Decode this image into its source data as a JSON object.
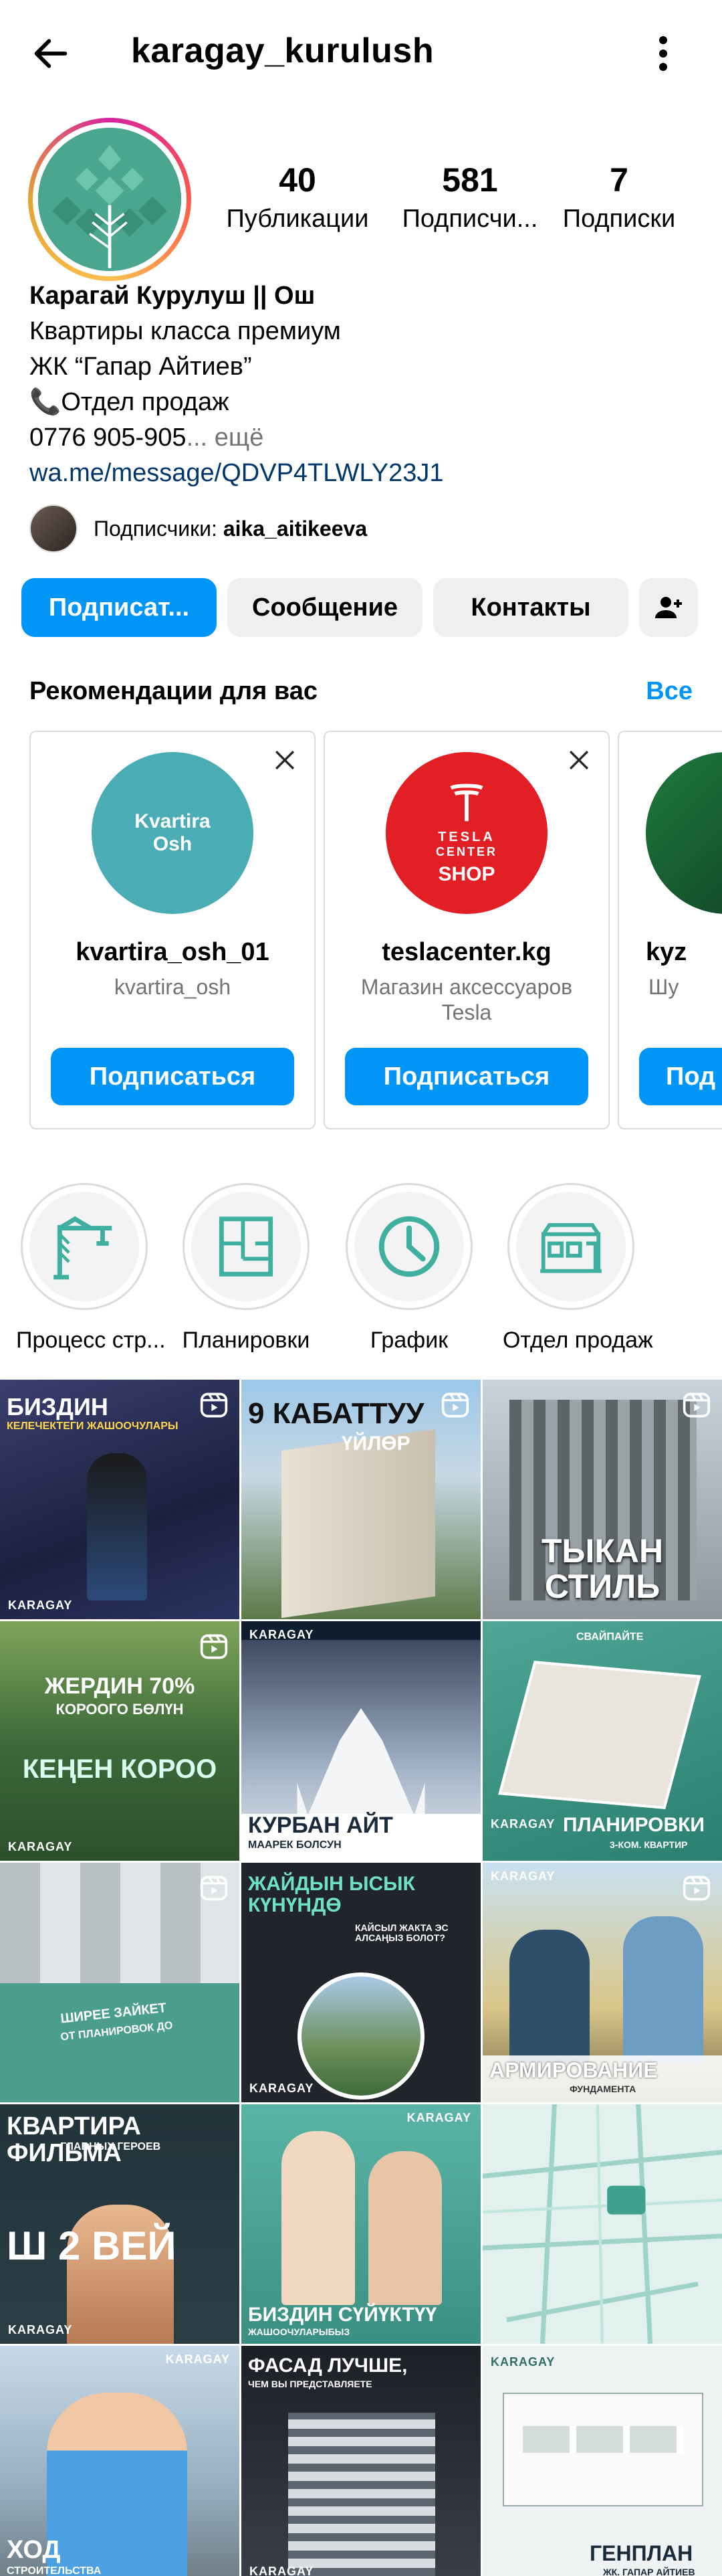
{
  "header": {
    "username": "karagay_kurulush"
  },
  "stats": [
    {
      "value": "40",
      "label": "Публикации"
    },
    {
      "value": "581",
      "label": "Подписчи..."
    },
    {
      "value": "7",
      "label": "Подписки"
    }
  ],
  "bio": {
    "name": "Карагай Курулуш || Ош",
    "line1": "Квартиры класса премиум",
    "line2": "ЖК “Гапар Айтиев”",
    "line3": "📞Отдел продаж",
    "line4": "0776 905-905",
    "more": "... ещё",
    "link": "wa.me/message/QDVP4TLWLY23J1"
  },
  "followers": {
    "prefix": "Подписчики: ",
    "name": "aika_aitikeeva"
  },
  "actions": {
    "follow": "Подписат...",
    "message": "Сообщение",
    "contacts": "Контакты"
  },
  "recommendations": {
    "title": "Рекомендации для вас",
    "see_all": "Все",
    "cards": [
      {
        "avatar_text_1": "Kvartira",
        "avatar_text_2": "Osh",
        "name": "kvartira_osh_01",
        "subtitle": "kvartira_osh",
        "button": "Подписаться"
      },
      {
        "avatar_text_1": "TESLA",
        "avatar_text_2": "CENTER",
        "avatar_text_3": "SHOP",
        "name": "teslacenter.kg",
        "subtitle": "Магазин аксессуаров Tesla",
        "button": "Подписаться"
      },
      {
        "name": "kyz",
        "subtitle": "Шу",
        "button": "Под"
      }
    ]
  },
  "highlights": [
    {
      "label": "Процесс стр...",
      "icon": "crane-icon"
    },
    {
      "label": "Планировки",
      "icon": "floorplan-icon"
    },
    {
      "label": "График",
      "icon": "clock-icon"
    },
    {
      "label": "Отдел продаж",
      "icon": "building-icon"
    }
  ],
  "grid": [
    {
      "text": "БИЗДИН",
      "sub": "КЕЛЕЧЕКТЕГИ ЖАШООЧУЛАРЫ",
      "brand": "KARAGAY",
      "reel": true
    },
    {
      "text": "9 КАБАТТУУ",
      "sub": "ҮЙЛӨР",
      "brand": "",
      "reel": true
    },
    {
      "text": "ТЫКАН СТИЛЬ",
      "sub": "",
      "brand": "",
      "reel": true
    },
    {
      "text": "ЖЕРДИН 70%",
      "sub": "КОРООГО БӨЛҮН",
      "text2": "КЕҢЕН КОРОО",
      "brand": "KARAGAY",
      "reel": true
    },
    {
      "text": "КУРБАН АЙТ",
      "sub": "МААРЕК БОЛСУН",
      "brand": "KARAGAY",
      "reel": false
    },
    {
      "text": "ПЛАНИРОВКИ",
      "sub": "3-КОМ. КВАРТИР",
      "top": "СВАЙПАЙТЕ",
      "brand": "KARAGAY",
      "reel": false
    },
    {
      "text": "ШИРЕЕ ЗАЙКЕТ",
      "sub": "ОТ ПЛАНИРОВОК ДО",
      "brand": "",
      "reel": true
    },
    {
      "text": "ЖАЙДЫН ЫСЫК КҮНҮНДӨ",
      "sub": "КАЙСЫЛ ЖАКТА ЭС АЛСАҢЫЗ БОЛОТ?",
      "brand": "KARAGAY",
      "reel": false
    },
    {
      "text": "АРМИРОВАНИЕ",
      "sub": "ФУНДАМЕНТА",
      "brand": "KARAGAY",
      "reel": true
    },
    {
      "text": "КВАРТИРА ФИЛЬМА",
      "sub": "ГЛАВНЫХ ГЕРОЕВ",
      "text2": "Ш 2 ВЕЙ",
      "brand": "KARAGAY",
      "reel": false
    },
    {
      "text": "БИЗДИН СҮЙҮКТҮҮ",
      "sub": "ЖАШООЧУЛАРЫБЫЗ",
      "brand": "KARAGAY",
      "reel": false
    },
    {
      "text": "",
      "sub": "",
      "brand": "",
      "reel": false
    },
    {
      "text": "ХОД",
      "sub": "СТРОИТЕЛЬСТВА",
      "brand": "KARAGAY",
      "reel": false
    },
    {
      "text": "ФАСАД ЛУЧШЕ,",
      "sub": "ЧЕМ ВЫ ПРЕДСТАВЛЯЕТЕ",
      "brand": "KARAGAY",
      "reel": false
    },
    {
      "text": "ГЕНПЛАН",
      "sub": "ЖК. ГАПАР АЙТИЕВ",
      "brand": "KARAGAY",
      "reel": false
    }
  ],
  "colors": {
    "primary": "#0095f6",
    "link": "#00376b",
    "muted": "#737373",
    "button_bg": "#efefef"
  }
}
